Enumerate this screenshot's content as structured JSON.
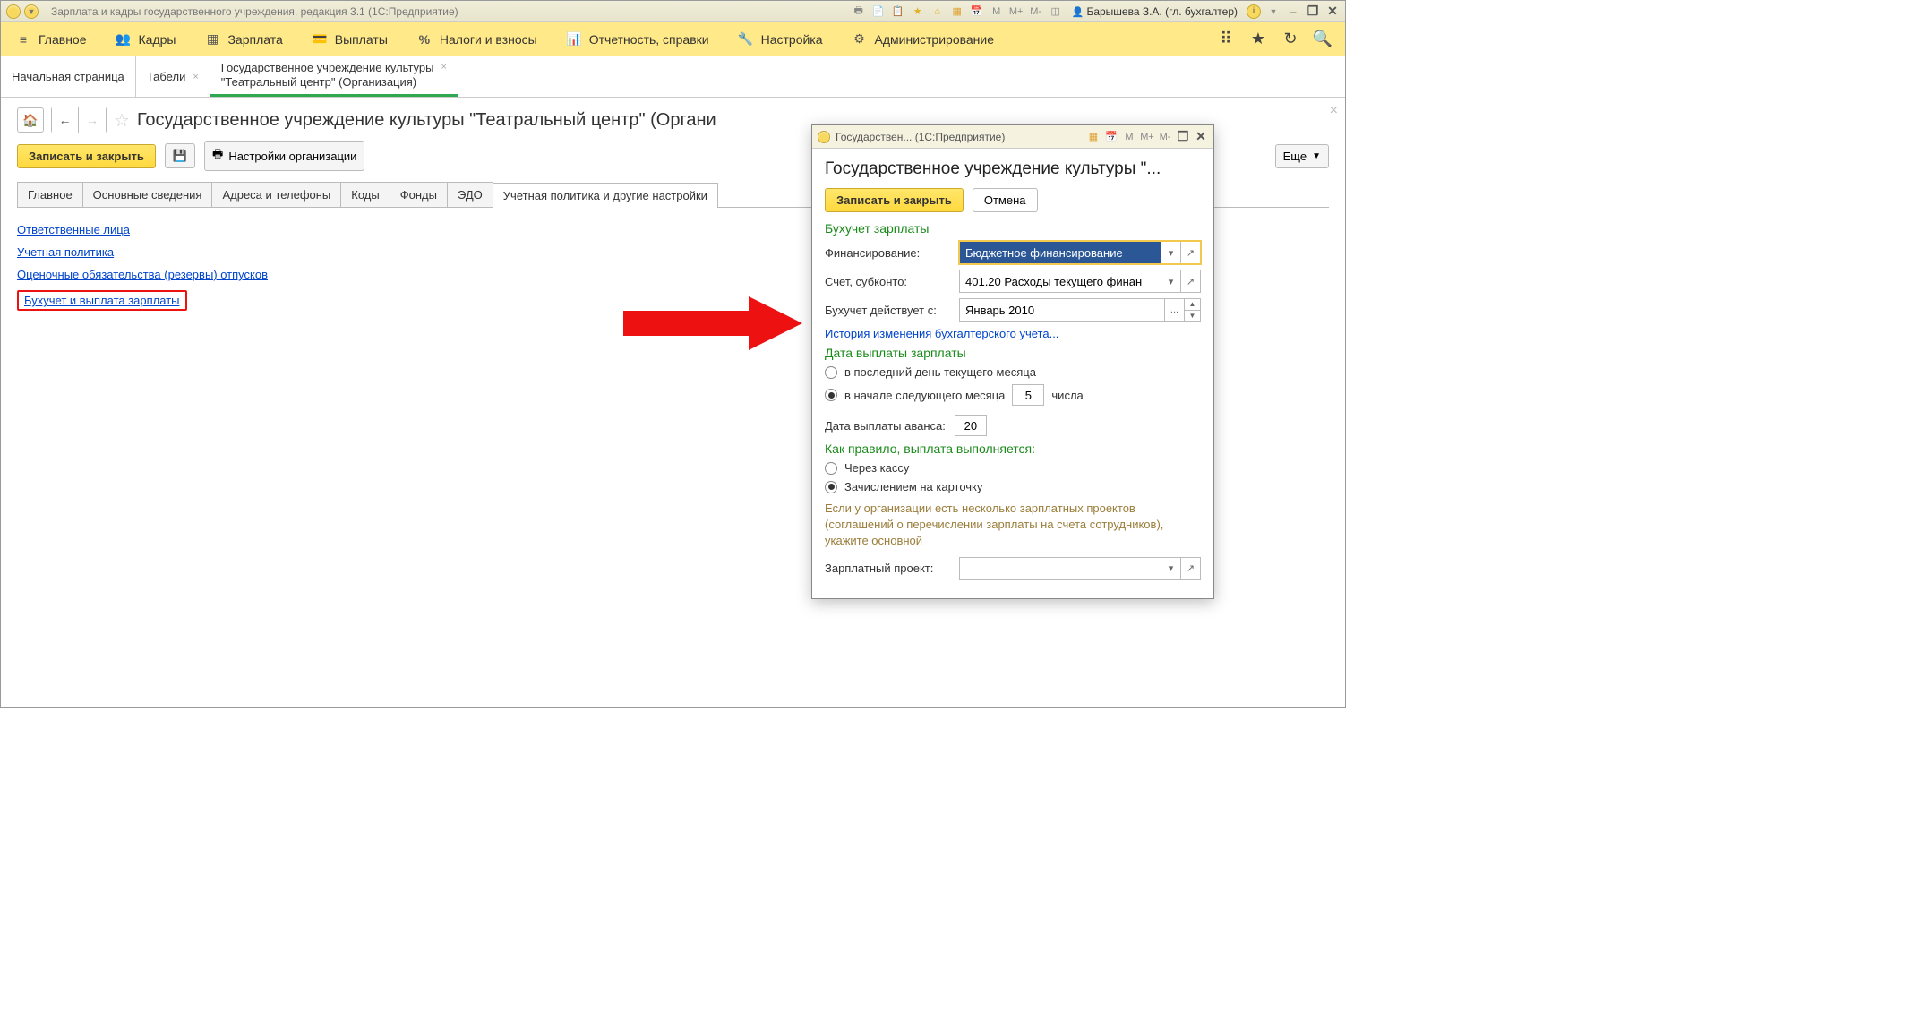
{
  "titlebar": {
    "title": "Зарплата и кадры государственного учреждения, редакция 3.1  (1С:Предприятие)",
    "user": "Барышева З.А. (гл. бухгалтер)",
    "memory_labels": [
      "M",
      "M+",
      "M-"
    ]
  },
  "menu": {
    "items": [
      {
        "icon": "menu",
        "label": "Главное"
      },
      {
        "icon": "people",
        "label": "Кадры"
      },
      {
        "icon": "table",
        "label": "Зарплата"
      },
      {
        "icon": "wallet",
        "label": "Выплаты"
      },
      {
        "icon": "percent",
        "label": "Налоги и взносы"
      },
      {
        "icon": "report",
        "label": "Отчетность, справки"
      },
      {
        "icon": "wrench",
        "label": "Настройка"
      },
      {
        "icon": "gear",
        "label": "Администрирование"
      }
    ]
  },
  "doctabs": [
    {
      "label": "Начальная страница",
      "closable": false
    },
    {
      "label": "Табели",
      "closable": true
    },
    {
      "label_line1": "Государственное учреждение культуры",
      "label_line2": "\"Театральный центр\" (Организация)",
      "closable": true,
      "active": true
    }
  ],
  "page": {
    "title": "Государственное учреждение культуры \"Театральный центр\" (Органи",
    "toolbar": {
      "save_close": "Записать и закрыть",
      "org_settings": "Настройки организации",
      "more": "Еще"
    },
    "subtabs": [
      "Главное",
      "Основные сведения",
      "Адреса и телефоны",
      "Коды",
      "Фонды",
      "ЭДО",
      "Учетная политика и другие настройки"
    ],
    "subtab_active": 6,
    "links": [
      "Ответственные лица",
      "Учетная политика",
      "Оценочные обязательства (резервы) отпусков",
      "Бухучет и выплата зарплаты"
    ],
    "link_highlight_index": 3
  },
  "popup": {
    "titlebar": "Государствен... (1С:Предприятие)",
    "heading": "Государственное учреждение культуры \"...",
    "toolbar": {
      "save_close": "Записать и закрыть",
      "cancel": "Отмена"
    },
    "section_accounting": "Бухучет зарплаты",
    "fields": {
      "financing_label": "Финансирование:",
      "financing_value": "Бюджетное финансирование",
      "account_label": "Счет, субконто:",
      "account_value": "401.20 Расходы текущего финан",
      "active_from_label": "Бухучет действует с:",
      "active_from_value": "Январь 2010"
    },
    "history_link": "История изменения бухгалтерского учета...",
    "section_paydate": "Дата выплаты зарплаты",
    "pay_options": {
      "opt1": "в последний день текущего месяца",
      "opt2_pre": "в начале следующего месяца",
      "opt2_day": "5",
      "opt2_suffix": "числа",
      "selected": "opt2"
    },
    "advance": {
      "label": "Дата выплаты аванса:",
      "value": "20"
    },
    "section_method": "Как правило, выплата выполняется:",
    "method_options": {
      "cash": "Через кассу",
      "card": "Зачислением на карточку",
      "selected": "card"
    },
    "help": "Если у организации есть несколько зарплатных проектов (соглашений о перечислении зарплаты на счета сотрудников), укажите основной",
    "project_label": "Зарплатный проект:",
    "project_value": ""
  }
}
